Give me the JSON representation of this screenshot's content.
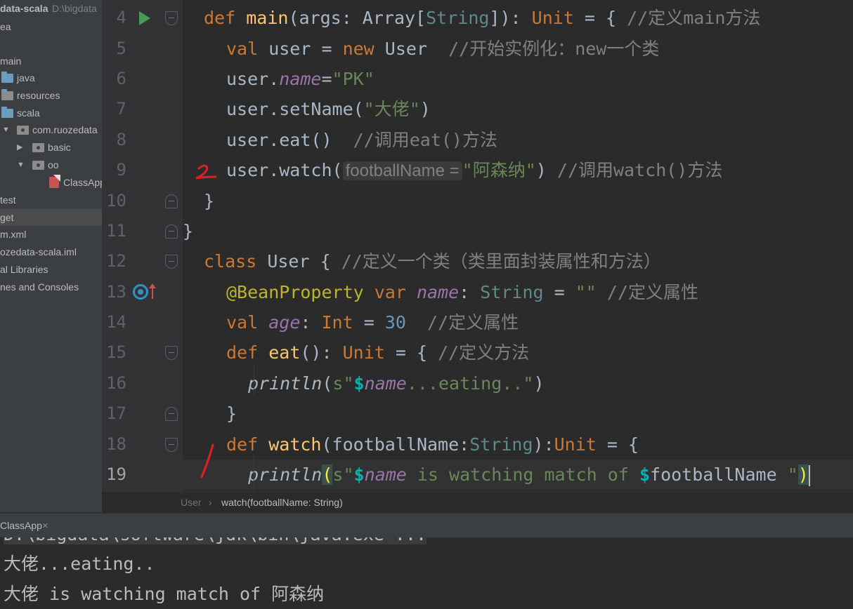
{
  "sidebar": {
    "items": [
      {
        "label": "data-scala",
        "hint": "D:\\bigdata"
      },
      {
        "label": "ea"
      },
      {
        "label": "main"
      },
      {
        "label": "java"
      },
      {
        "label": "resources"
      },
      {
        "label": "scala"
      },
      {
        "label": "com.ruozedata"
      },
      {
        "label": "basic"
      },
      {
        "label": "oo"
      },
      {
        "label": "ClassApp"
      },
      {
        "label": "test"
      },
      {
        "label": "get"
      },
      {
        "label": "m.xml"
      },
      {
        "label": "ozedata-scala.iml"
      },
      {
        "label": "al Libraries"
      },
      {
        "label": "nes and Consoles"
      }
    ]
  },
  "editor": {
    "line_numbers": [
      "4",
      "5",
      "6",
      "7",
      "8",
      "9",
      "10",
      "11",
      "12",
      "13",
      "14",
      "15",
      "16",
      "17",
      "18",
      "19"
    ],
    "current_line": "19",
    "lines": {
      "l4": {
        "kw": "def",
        "name": "main",
        "rest1": "(args: Array[",
        "ptype": "String",
        "rest2": "]): ",
        "type": "Unit",
        "rest3": " = { ",
        "cmt": "//定义main方法"
      },
      "l5": {
        "kw1": "val",
        "rest1": " user = ",
        "kw2": "new",
        "rest2": " User  ",
        "cmt": "//开始实例化：new一个类"
      },
      "l6": {
        "pre": "user.",
        "fld": "name",
        "eq": "=",
        "str": "\"PK\""
      },
      "l7": {
        "pre": "user.setName(",
        "str": "\"大佬\"",
        "post": ")"
      },
      "l8": {
        "pre": "user.eat()  ",
        "cmt": "//调用eat()方法"
      },
      "l9": {
        "pre": "user.watch(",
        "hint": "footballName =",
        "str": "\"阿森纳\"",
        "post": ") ",
        "cmt": "//调用watch()方法"
      },
      "l10": {
        "text": "}"
      },
      "l11": {
        "text": "}"
      },
      "l12": {
        "kw": "class",
        "rest": " User { ",
        "cmt": "//定义一个类（类里面封装属性和方法）"
      },
      "l13": {
        "ann": "@BeanProperty",
        "kw": "var",
        "fld": "name",
        "colon": ": ",
        "ptype": "String",
        "eq": " = ",
        "str": "\"\"",
        "cmt": "//定义属性"
      },
      "l14": {
        "kw": "val",
        "fld": "age",
        "colon": ": ",
        "type": "Int",
        "eq": " = ",
        "num": "30",
        "cmt": "//定义属性"
      },
      "l15": {
        "kw": "def",
        "name": "eat",
        "rest1": "(): ",
        "type": "Unit",
        "rest2": " = { ",
        "cmt": "//定义方法"
      },
      "l16": {
        "fn": "println",
        "open": "(",
        "s": "s\"",
        "interp": "$",
        "fld": "name",
        "str": "...eating..\"",
        "close": ")"
      },
      "l17": {
        "text": "}"
      },
      "l18": {
        "kw": "def",
        "name": "watch",
        "rest1": "(footballName:",
        "ptype": "String",
        "rest2": "):",
        "type": "Unit",
        "rest3": " = {"
      },
      "l19": {
        "fn": "println",
        "open": "(",
        "s": "s\"",
        "interp1": "$",
        "fld": "name",
        "str1": " is watching match of ",
        "interp2": "$",
        "var": "footballName",
        "str2": " \"",
        "close": ")"
      }
    },
    "annotations": {
      "mark1": "1",
      "mark2": "2"
    }
  },
  "breadcrumb": {
    "item1": "User",
    "separator": "›",
    "item2": "watch(footballName: String)"
  },
  "run": {
    "tab_label": "ClassApp",
    "close_glyph": "×",
    "output": [
      "D:\\bigdata\\software\\jdk\\bin\\java.exe ...",
      "大佬...eating..",
      "大佬 is watching match of 阿森纳"
    ]
  },
  "colors": {
    "keyword": "#cc7832",
    "string": "#6a8759",
    "comment": "#808080",
    "field": "#9876aa",
    "annotation_mark": "#e02020"
  }
}
